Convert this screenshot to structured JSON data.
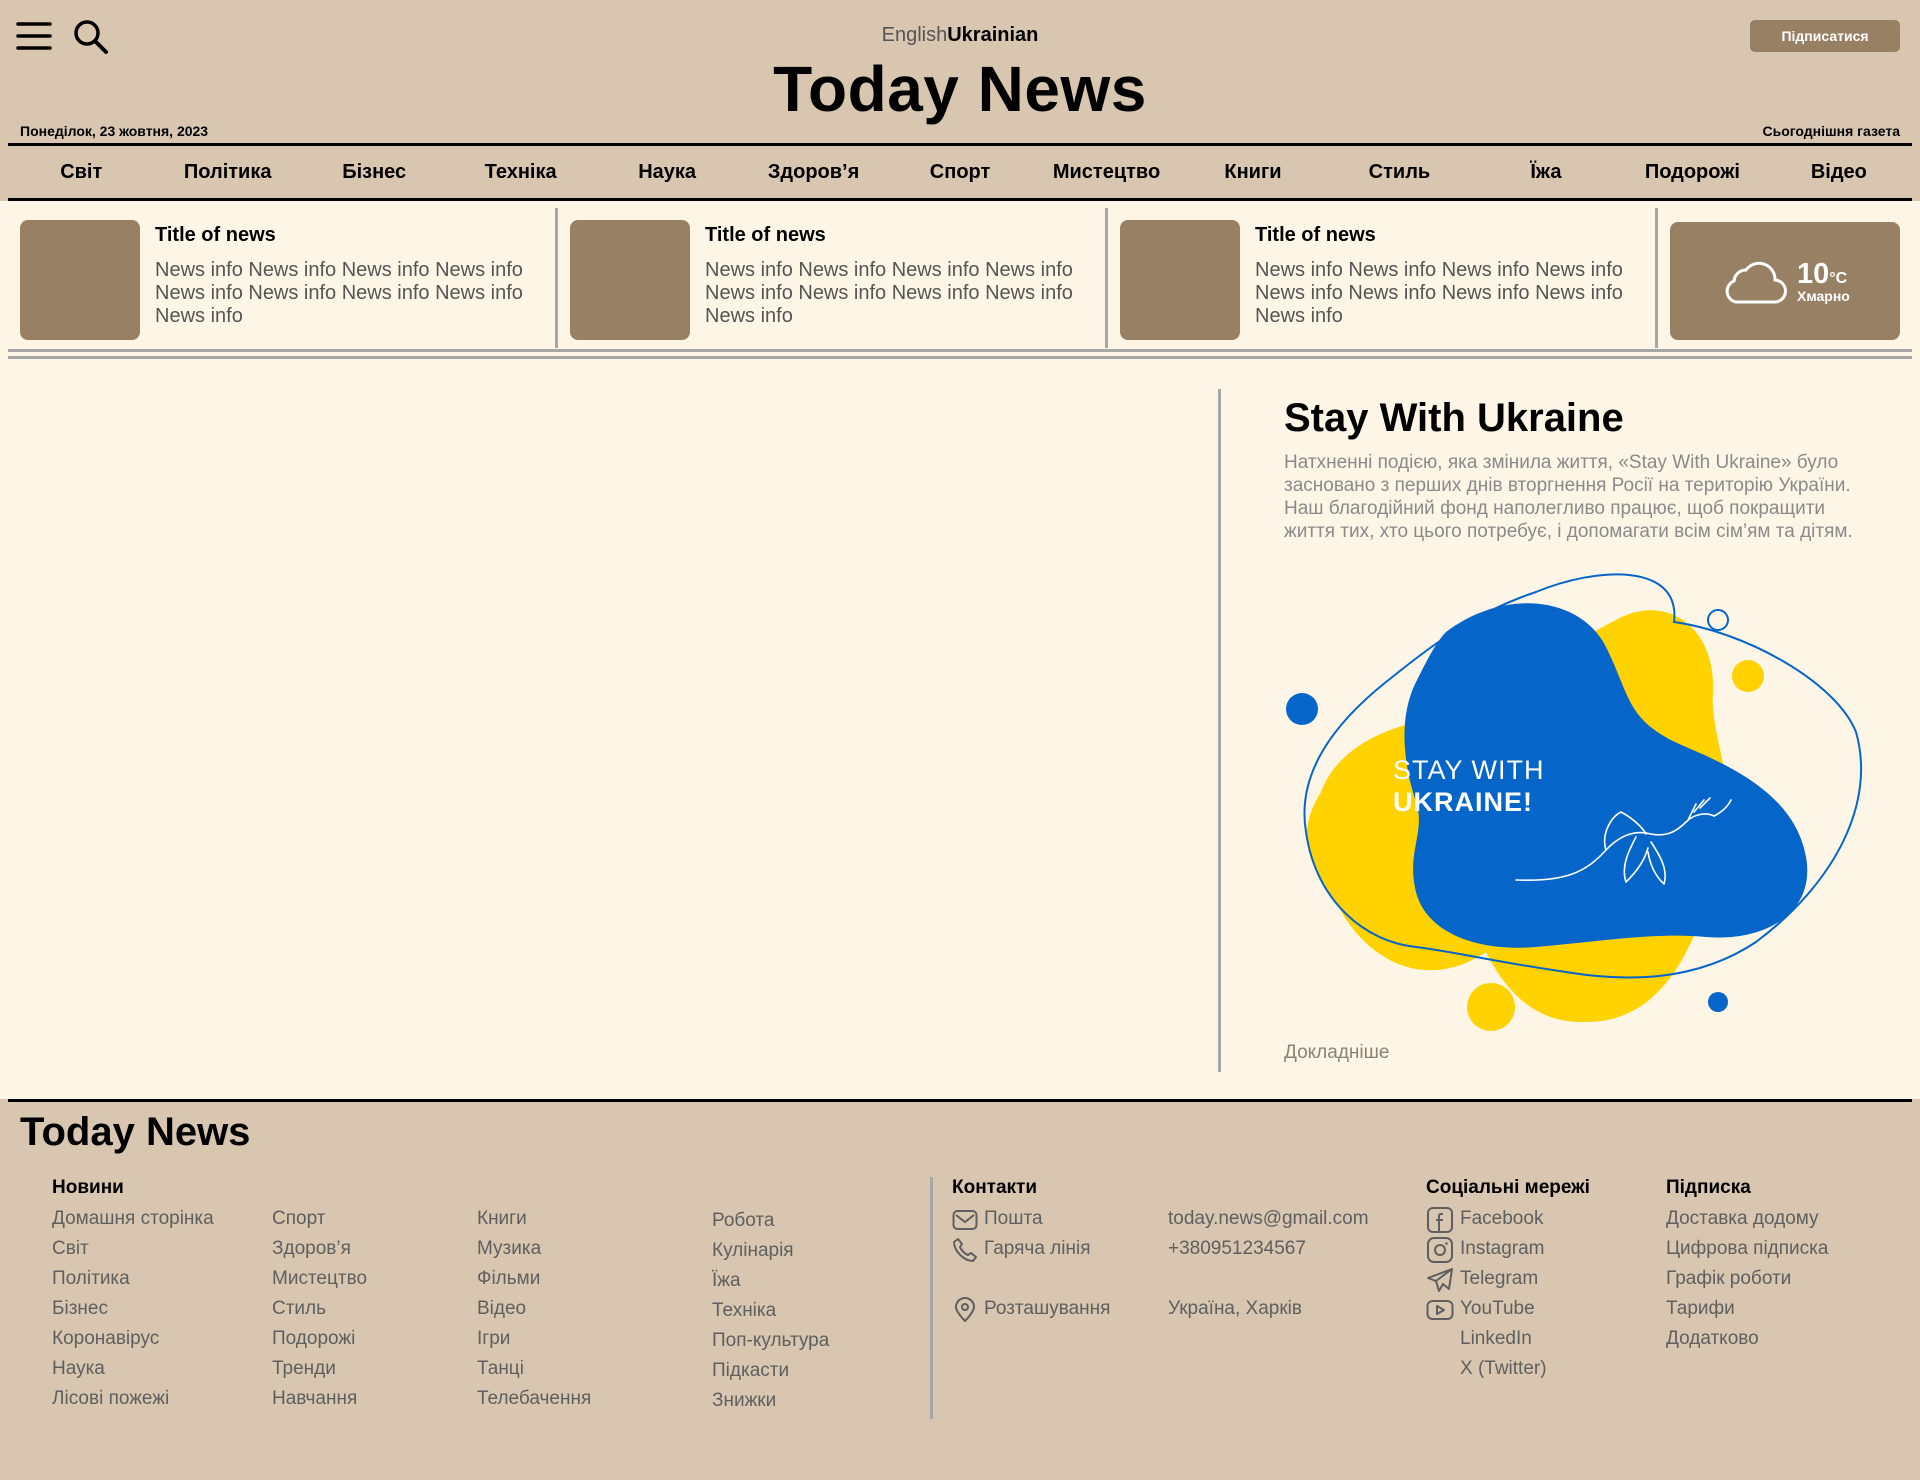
{
  "header": {
    "lang_en": "English",
    "lang_uk": "Ukrainian",
    "logo": "Today News",
    "subscribe": "Підписатися",
    "date": "Понеділок, 23 жовтня, 2023",
    "today_paper": "Сьогоднішня газета"
  },
  "nav": [
    "Світ",
    "Політика",
    "Бізнес",
    "Техніка",
    "Наука",
    "Здоров’я",
    "Спорт",
    "Мистецтво",
    "Книги",
    "Стиль",
    "Їжа",
    "Подорожі",
    "Відео"
  ],
  "news": [
    {
      "title": "Title of news",
      "info": "News info News info News info News info News info News info News info News info News info"
    },
    {
      "title": "Title of news",
      "info": "News info News info News info News info News info News info News info News info News info"
    },
    {
      "title": "Title of news",
      "info": "News info News info News info News info News info News info News info News info News info"
    }
  ],
  "weather": {
    "temp": "10",
    "unit": "°C",
    "condition": "Хмарно",
    "icon": "cloud-icon"
  },
  "promo": {
    "title": "Stay With Ukraine",
    "text": "Натхненні подією, яка змінила життя, «Stay With Ukraine» було засновано з перших днів вторгнення Росії на територію України. Наш благодійний фонд наполегливо працює, щоб покращити життя тих, хто цього потребує, і допомагати всім сім’ям та дітям.",
    "graphic_line1": "STAY WITH",
    "graphic_line2": "UKRAINE!",
    "more": "Докладніше",
    "colors": {
      "blue": "#0565c8",
      "yellow": "#ffd200"
    }
  },
  "footer": {
    "logo": "Today News",
    "news_heading": "Новини",
    "news_col1": [
      "Домашня сторінка",
      "Світ",
      "Політика",
      "Бізнес",
      "Коронавірус",
      "Наука",
      "Лісові пожежі"
    ],
    "news_col2": [
      "Спорт",
      "Здоров’я",
      "Мистецтво",
      "Стиль",
      "Подорожі",
      "Тренди",
      "Навчання"
    ],
    "news_col3": [
      "Книги",
      "Музика",
      "Фільми",
      "Відео",
      "Ігри",
      "Танці",
      "Телебачення"
    ],
    "news_col4": [
      "Робота",
      "Кулінарія",
      "Їжа",
      "Техніка",
      "Поп-культура",
      "Підкасти",
      "Знижки"
    ],
    "contacts_heading": "Контакти",
    "contacts": [
      {
        "label": "Пошта",
        "value": "today.news@gmail.com",
        "icon": "mail-icon"
      },
      {
        "label": "Гаряча лінія",
        "value": "+380951234567",
        "icon": "phone-icon"
      },
      {
        "label": "Розташування",
        "value": "Україна, Харків",
        "icon": "location-icon"
      }
    ],
    "social_heading": "Соціальні мережі",
    "social": [
      {
        "label": "Facebook",
        "icon": "facebook-icon"
      },
      {
        "label": "Instagram",
        "icon": "instagram-icon"
      },
      {
        "label": "Telegram",
        "icon": "telegram-icon"
      },
      {
        "label": "YouTube",
        "icon": "youtube-icon"
      },
      {
        "label": "LinkedIn",
        "icon": ""
      },
      {
        "label": "X (Twitter)",
        "icon": ""
      }
    ],
    "subscription_heading": "Підписка",
    "subscription": [
      "Доставка додому",
      "Цифрова підписка",
      "Графік роботи",
      "Тарифи",
      "Додатково"
    ]
  },
  "colors": {
    "page_bg": "#d8c6b0",
    "content_bg": "#fdf6e7",
    "accent": "#988064",
    "divider": "#a7a7a7"
  }
}
